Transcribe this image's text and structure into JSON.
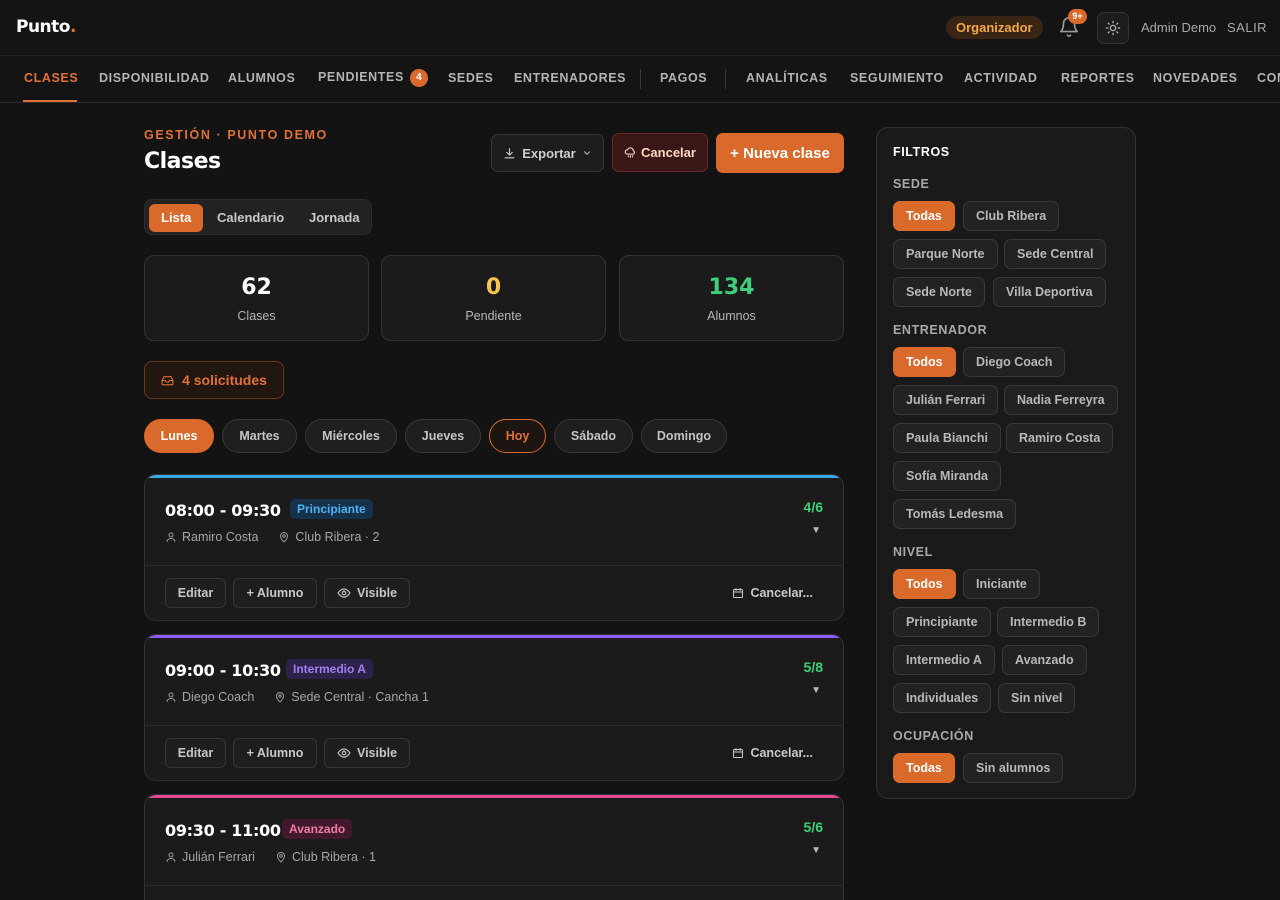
{
  "app": {
    "brand": "Punto",
    "brand_dot": ".",
    "role": "Organizador",
    "notifications": "9+",
    "user": "Admin Demo",
    "logout": "SALIR"
  },
  "nav": {
    "items": [
      "CLASES",
      "DISPONIBILIDAD",
      "ALUMNOS",
      "PENDIENTES",
      "SEDES",
      "ENTRENADORES",
      "PAGOS",
      "ANALÍTICAS",
      "SEGUIMIENTO",
      "ACTIVIDAD",
      "REPORTES",
      "NOVEDADES",
      "COM"
    ],
    "pending_count": "4",
    "active": "CLASES"
  },
  "header": {
    "eyebrow": "GESTIÓN · PUNTO DEMO",
    "title": "Clases",
    "export_label": "Exportar",
    "cancel_label": "Cancelar",
    "new_label": "+ Nueva clase"
  },
  "views": {
    "items": [
      "Lista",
      "Calendario",
      "Jornada"
    ],
    "active": "Lista"
  },
  "stats": [
    {
      "value": "62",
      "label": "Clases",
      "color": "#ffffff"
    },
    {
      "value": "0",
      "label": "Pendiente",
      "color": "#f5c451"
    },
    {
      "value": "134",
      "label": "Alumnos",
      "color": "#3ecf7a"
    }
  ],
  "requests_label": "4 solicitudes",
  "days": {
    "items": [
      "Lunes",
      "Martes",
      "Miércoles",
      "Jueves",
      "Hoy",
      "Sábado",
      "Domingo"
    ],
    "active": "Lunes",
    "today": "Hoy"
  },
  "classes": [
    {
      "time": "08:00 - 09:30",
      "level": "Principiante",
      "level_color": "#4fb0f0",
      "level_bg": "#15324a",
      "stripe": "#3aa7e8",
      "coach": "Ramiro Costa",
      "location": "Club Ribera · 2",
      "occupancy": "4/6"
    },
    {
      "time": "09:00 - 10:30",
      "level": "Intermedio A",
      "level_color": "#a07ff0",
      "level_bg": "#2c2148",
      "stripe": "#8b5cf6",
      "coach": "Diego Coach",
      "location": "Sede Central · Cancha 1",
      "occupancy": "5/8"
    },
    {
      "time": "09:30 - 11:00",
      "level": "Avanzado",
      "level_color": "#f07aa8",
      "level_bg": "#42192c",
      "stripe": "#e5498f",
      "coach": "Julián Ferrari",
      "location": "Club Ribera · 1",
      "occupancy": "5/6"
    }
  ],
  "class_actions": {
    "edit": "Editar",
    "add_student": "+ Alumno",
    "visible": "Visible",
    "cancel": "Cancelar..."
  },
  "filters": {
    "title": "FILTROS",
    "sede": {
      "label": "SEDE",
      "options": [
        "Todas",
        "Club Ribera",
        "Parque Norte",
        "Sede Central",
        "Sede Norte",
        "Villa Deportiva"
      ],
      "active": "Todas"
    },
    "entrenador": {
      "label": "ENTRENADOR",
      "options": [
        "Todos",
        "Diego Coach",
        "Julián Ferrari",
        "Nadia Ferreyra",
        "Paula Bianchi",
        "Ramiro Costa",
        "Sofía Miranda",
        "Tomás Ledesma"
      ],
      "active": "Todos"
    },
    "nivel": {
      "label": "NIVEL",
      "options": [
        "Todos",
        "Iniciante",
        "Principiante",
        "Intermedio B",
        "Intermedio A",
        "Avanzado",
        "Individuales",
        "Sin nivel"
      ],
      "active": "Todos"
    },
    "ocupacion": {
      "label": "OCUPACIÓN",
      "options": [
        "Todas",
        "Sin alumnos"
      ],
      "active": "Todas"
    }
  },
  "colors": {
    "accent": "#d96a2b",
    "accent_text": "#e0703a",
    "background": "#131313"
  },
  "icons": [
    "bell-icon",
    "sun-icon",
    "download-icon",
    "chevron-down-icon",
    "rain-cloud-icon",
    "inbox-icon",
    "user-icon",
    "map-pin-icon",
    "eye-icon",
    "calendar-icon"
  ]
}
